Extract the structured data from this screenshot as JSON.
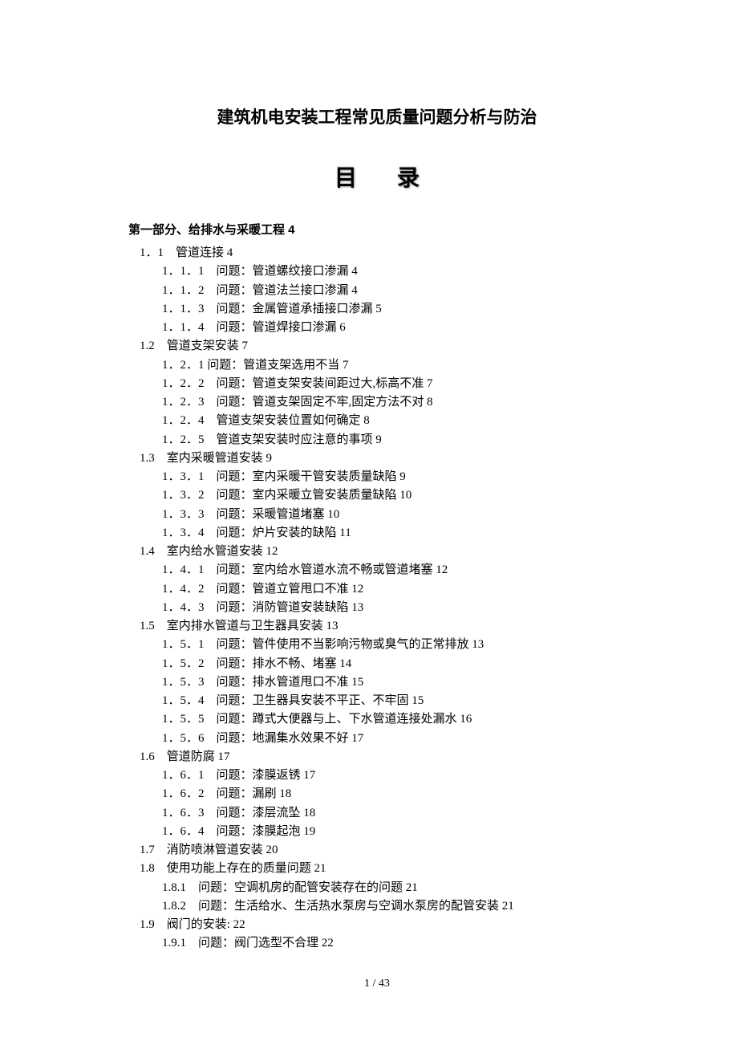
{
  "title": "建筑机电安装工程常见质量问题分析与防治",
  "toc_header": "目录",
  "part_header": "第一部分、给排水与采暖工程 4",
  "toc": [
    {
      "lvl": 1,
      "t": "1．1　管道连接 4"
    },
    {
      "lvl": 2,
      "t": "1．1．1　问题：管道螺纹接口渗漏 4"
    },
    {
      "lvl": 2,
      "t": "1．1．2　问题：管道法兰接口渗漏 4"
    },
    {
      "lvl": 2,
      "t": "1．1．3　问题：金属管道承插接口渗漏 5"
    },
    {
      "lvl": 2,
      "t": "1．1．4　问题：管道焊接口渗漏 6"
    },
    {
      "lvl": 1,
      "t": "1.2　管道支架安装 7"
    },
    {
      "lvl": 2,
      "t": "1．2．1 问题：管道支架选用不当 7"
    },
    {
      "lvl": 2,
      "t": "1．2．2　问题：管道支架安装间距过大,标高不准 7"
    },
    {
      "lvl": 2,
      "t": "1．2．3　问题：管道支架固定不牢,固定方法不对 8"
    },
    {
      "lvl": 2,
      "t": "1．2．4　管道支架安装位置如何确定 8"
    },
    {
      "lvl": 2,
      "t": "1．2．5　管道支架安装时应注意的事项 9"
    },
    {
      "lvl": 1,
      "t": "1.3　室内采暖管道安装 9"
    },
    {
      "lvl": 2,
      "t": "1．3．1　问题：室内采暖干管安装质量缺陷 9"
    },
    {
      "lvl": 2,
      "t": "1．3．2　问题：室内采暖立管安装质量缺陷 10"
    },
    {
      "lvl": 2,
      "t": "1．3．3　问题：采暖管道堵塞 10"
    },
    {
      "lvl": 2,
      "t": "1．3．4　问题：炉片安装的缺陷 11"
    },
    {
      "lvl": 1,
      "t": "1.4　室内给水管道安装 12"
    },
    {
      "lvl": 2,
      "t": "1．4．1　问题：室内给水管道水流不畅或管道堵塞 12"
    },
    {
      "lvl": 2,
      "t": "1．4．2　问题：管道立管甩口不准 12"
    },
    {
      "lvl": 2,
      "t": "1．4．3　问题：消防管道安装缺陷 13"
    },
    {
      "lvl": 1,
      "t": "1.5　室内排水管道与卫生器具安装 13"
    },
    {
      "lvl": 2,
      "t": "1．5．1　问题：管件使用不当影响污物或臭气的正常排放 13"
    },
    {
      "lvl": 2,
      "t": "1．5．2　问题：排水不畅、堵塞 14"
    },
    {
      "lvl": 2,
      "t": "1．5．3　问题：排水管道甩口不准 15"
    },
    {
      "lvl": 2,
      "t": "1．5．4　问题：卫生器具安装不平正、不牢固 15"
    },
    {
      "lvl": 2,
      "t": "1．5．5　问题：蹲式大便器与上、下水管道连接处漏水 16"
    },
    {
      "lvl": 2,
      "t": "1．5．6　问题：地漏集水效果不好 17"
    },
    {
      "lvl": 1,
      "t": "1.6　管道防腐 17"
    },
    {
      "lvl": 2,
      "t": "1．6．1　问题：漆膜返锈 17"
    },
    {
      "lvl": 2,
      "t": "1．6．2　问题：漏刷 18"
    },
    {
      "lvl": 2,
      "t": "1．6．3　问题：漆层流坠 18"
    },
    {
      "lvl": 2,
      "t": "1．6．4　问题：漆膜起泡 19"
    },
    {
      "lvl": 1,
      "t": "1.7　消防喷淋管道安装 20"
    },
    {
      "lvl": 1,
      "t": "1.8　使用功能上存在的质量问题 21"
    },
    {
      "lvl": 2,
      "t": "1.8.1　问题：空调机房的配管安装存在的问题 21"
    },
    {
      "lvl": 2,
      "t": "1.8.2　问题：生活给水、生活热水泵房与空调水泵房的配管安装 21"
    },
    {
      "lvl": 1,
      "t": "1.9　阀门的安装: 22"
    },
    {
      "lvl": 2,
      "t": "1.9.1　问题：阀门选型不合理 22"
    }
  ],
  "page_number": "1  / 43"
}
